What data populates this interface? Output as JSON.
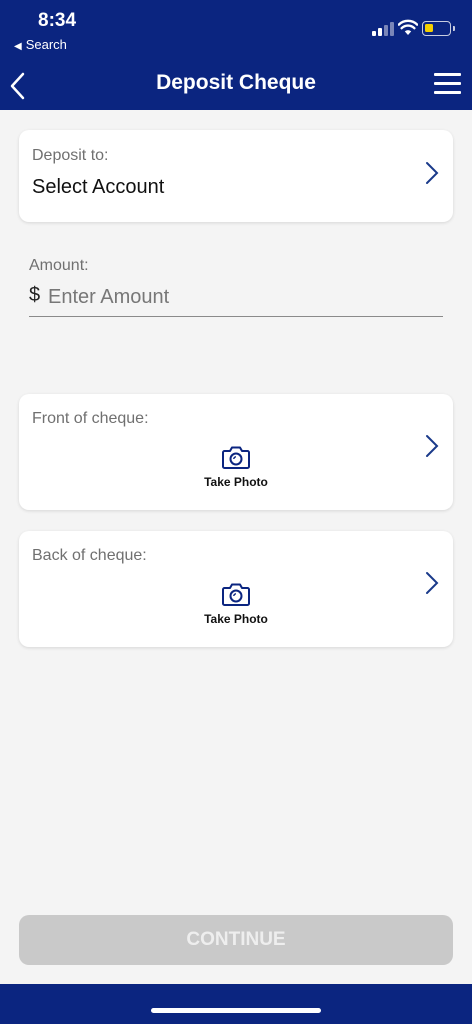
{
  "status_bar": {
    "time": "8:34",
    "back_app": "Search",
    "battery_color": "#f5d000"
  },
  "nav": {
    "title": "Deposit Cheque",
    "background": "#0b2580"
  },
  "deposit_to": {
    "label": "Deposit to:",
    "value": "Select Account"
  },
  "amount": {
    "label": "Amount:",
    "currency": "$",
    "placeholder": "Enter Amount"
  },
  "front": {
    "label": "Front of cheque:",
    "action": "Take Photo"
  },
  "back": {
    "label": "Back of cheque:",
    "action": "Take Photo"
  },
  "continue_button": {
    "label": "CONTINUE",
    "enabled": false
  },
  "colors": {
    "brand": "#0b2580",
    "disabled": "#c9c9c9",
    "background": "#f4f4f4"
  }
}
